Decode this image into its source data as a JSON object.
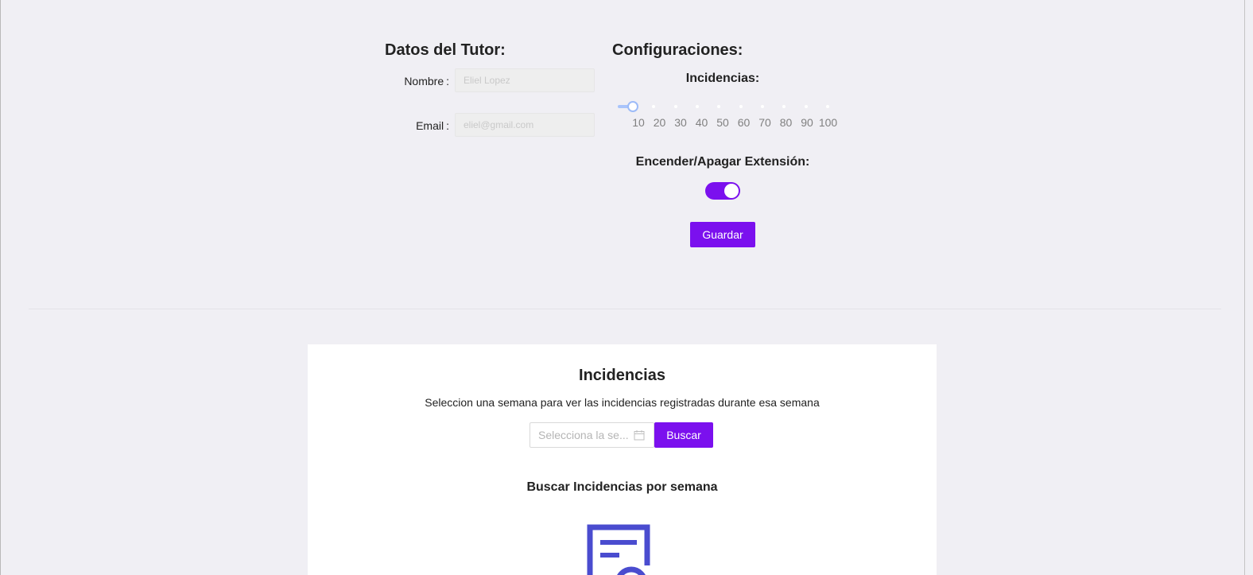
{
  "tutor": {
    "title": "Datos del Tutor:",
    "name_label": "Nombre",
    "name_placeholder": "Eliel Lopez",
    "email_label": "Email",
    "email_placeholder": "eliel@gmail.com"
  },
  "config": {
    "title": "Configuraciones:",
    "incidents_label": "Incidencias:",
    "slider": {
      "value": 10,
      "min": 10,
      "max": 100,
      "marks": [
        "10",
        "20",
        "30",
        "40",
        "50",
        "60",
        "70",
        "80",
        "90",
        "100"
      ]
    },
    "extension_label": "Encender/Apagar Extensión:",
    "extension_on": true,
    "save_label": "Guardar"
  },
  "incidents_panel": {
    "title": "Incidencias",
    "description": "Seleccion una semana para ver las incidencias registradas durante esa semana",
    "week_placeholder": "Selecciona la se...",
    "search_label": "Buscar",
    "empty_title": "Buscar Incidencias por semana"
  },
  "colors": {
    "accent": "#7b10ee",
    "background": "#f0eff4",
    "slider": "#a9c4fb",
    "icon": "#4a4ccf"
  },
  "icons": [
    "calendar-icon",
    "document-search-icon"
  ]
}
